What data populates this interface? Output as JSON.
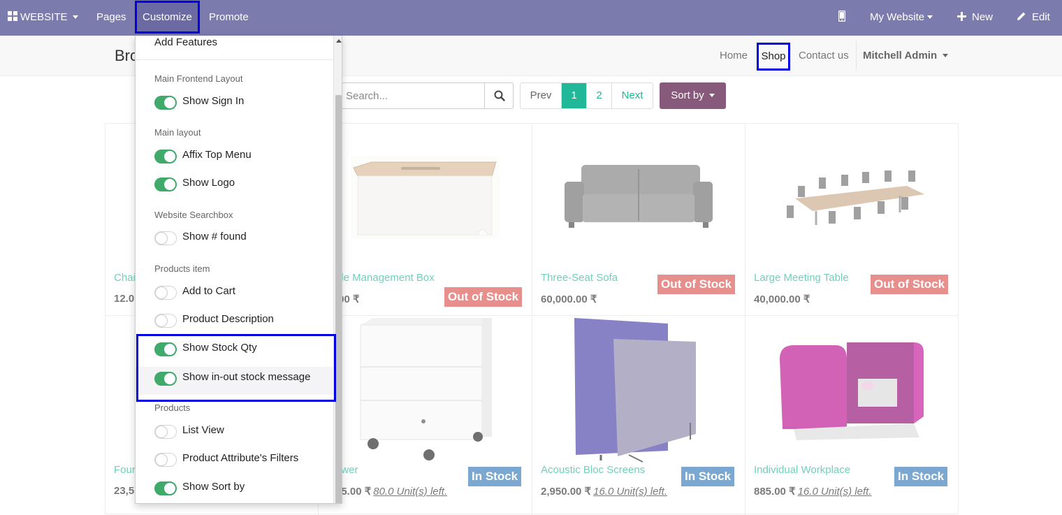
{
  "topbar": {
    "app_label": "WEBSITE",
    "pages": "Pages",
    "customize": "Customize",
    "promote": "Promote",
    "my_website": "My Website",
    "new": "New",
    "edit": "Edit"
  },
  "header": {
    "brand": "Bro",
    "nav": {
      "home": "Home",
      "shop": "Shop",
      "contact": "Contact us",
      "user": "Mitchell Admin"
    }
  },
  "search": {
    "placeholder": "Search..."
  },
  "pager": {
    "prev": "Prev",
    "pages": [
      "1",
      "2"
    ],
    "next": "Next"
  },
  "sort": {
    "label": "Sort by"
  },
  "customize_menu": {
    "add_features": "Add Features",
    "sections": [
      {
        "title": "Main Frontend Layout",
        "options": [
          {
            "label": "Show Sign In",
            "on": true
          }
        ]
      },
      {
        "title": "Main layout",
        "options": [
          {
            "label": "Affix Top Menu",
            "on": true
          },
          {
            "label": "Show Logo",
            "on": true
          }
        ]
      },
      {
        "title": "Website Searchbox",
        "options": [
          {
            "label": "Show # found",
            "on": false
          }
        ]
      },
      {
        "title": "Products item",
        "options": [
          {
            "label": "Add to Cart",
            "on": false
          },
          {
            "label": "Product Description",
            "on": false
          },
          {
            "label": "Show Stock Qty",
            "on": true
          },
          {
            "label": "Show in-out stock message",
            "on": true
          }
        ]
      },
      {
        "title": "Products",
        "options": [
          {
            "label": "List View",
            "on": false
          },
          {
            "label": "Product Attribute's Filters",
            "on": false
          },
          {
            "label": "Show Sort by",
            "on": true
          }
        ]
      }
    ]
  },
  "products": [
    {
      "name": "Chai",
      "price": "12.0",
      "qty": "",
      "badge": "",
      "badge_type": ""
    },
    {
      "name": "ble Management Box",
      "price": ".00 ₹",
      "qty": "",
      "badge": "Out of Stock",
      "badge_type": "out"
    },
    {
      "name": "Three-Seat Sofa",
      "price": "60,000.00 ₹",
      "qty": "",
      "badge": "Out of Stock",
      "badge_type": "out"
    },
    {
      "name": "Large Meeting Table",
      "price": "40,000.00 ₹",
      "qty": "",
      "badge": "Out of Stock",
      "badge_type": "out"
    },
    {
      "name": "Four",
      "price": "23,5",
      "qty": "",
      "badge": "",
      "badge_type": ""
    },
    {
      "name": "awer",
      "price": "45.00 ₹",
      "qty": "80.0 Unit(s) left.",
      "badge": "In Stock",
      "badge_type": "in"
    },
    {
      "name": "Acoustic Bloc Screens",
      "price": "2,950.00 ₹",
      "qty": "16.0 Unit(s) left.",
      "badge": "In Stock",
      "badge_type": "in"
    },
    {
      "name": "Individual Workplace",
      "price": "885.00 ₹",
      "qty": "16.0 Unit(s) left.",
      "badge": "In Stock",
      "badge_type": "in"
    }
  ],
  "colors": {
    "topbar": "#7c7bad",
    "accent": "#21b799",
    "sort_button": "#875a7b",
    "toggle_on": "#3faa69",
    "highlight": "#0000e0"
  }
}
